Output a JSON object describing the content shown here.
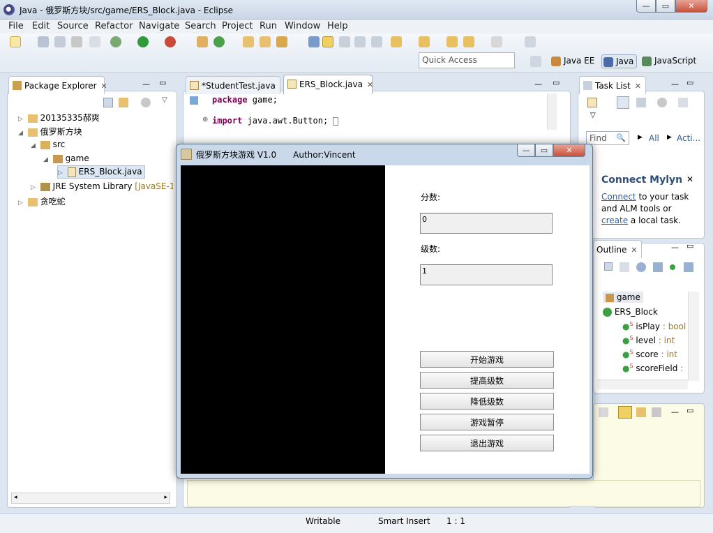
{
  "window": {
    "title": "Java - 俄罗斯方块/src/game/ERS_Block.java - Eclipse",
    "minimize": "—",
    "maximize": "▭",
    "close": "✕"
  },
  "menu": [
    "File",
    "Edit",
    "Source",
    "Refactor",
    "Navigate",
    "Search",
    "Project",
    "Run",
    "Window",
    "Help"
  ],
  "quick_access": {
    "placeholder": "Quick Access"
  },
  "perspectives": [
    "Java EE",
    "Java",
    "JavaScript"
  ],
  "package_explorer": {
    "tab": "Package Explorer",
    "tree": [
      {
        "label": "20135335郝爽"
      },
      {
        "label": "俄罗斯方块"
      },
      {
        "label": "src"
      },
      {
        "label": "game"
      },
      {
        "label": "ERS_Block.java"
      },
      {
        "label": "JRE System Library",
        "suffix": "[JavaSE-1"
      },
      {
        "label": "贪吃蛇"
      }
    ]
  },
  "editor": {
    "tabs": [
      "*StudentTest.java",
      "ERS_Block.java"
    ],
    "lines": [
      {
        "kw": "package",
        "rest": " game;"
      },
      {
        "kw": "import",
        "rest": " java.awt.Button;"
      }
    ]
  },
  "task_list": {
    "tab": "Task List",
    "find_placeholder": "Find",
    "all": "All",
    "activate": "Acti..."
  },
  "mylyn": {
    "title": "Connect Mylyn",
    "link1": "Connect",
    "text1": " to your task",
    "text2": "and ALM tools or",
    "link2": "create",
    "text3": " a local task."
  },
  "outline": {
    "tab": "Outline",
    "items": [
      {
        "name": "game",
        "type": ""
      },
      {
        "name": "ERS_Block",
        "type": ""
      },
      {
        "name": "isPlay",
        "type": " : bool"
      },
      {
        "name": "level",
        "type": " : int"
      },
      {
        "name": "score",
        "type": " : int"
      },
      {
        "name": "scoreField",
        "type": " :"
      }
    ]
  },
  "status": {
    "writable": "Writable",
    "insert": "Smart Insert",
    "position": "1 : 1"
  },
  "game": {
    "title": "俄罗斯方块游戏  V1.0",
    "author": "Author:Vincent",
    "score_label": "分数:",
    "score_value": "0",
    "level_label": "级数:",
    "level_value": "1",
    "buttons": [
      "开始游戏",
      "提高级数",
      "降低级数",
      "游戏暂停",
      "退出游戏"
    ]
  }
}
